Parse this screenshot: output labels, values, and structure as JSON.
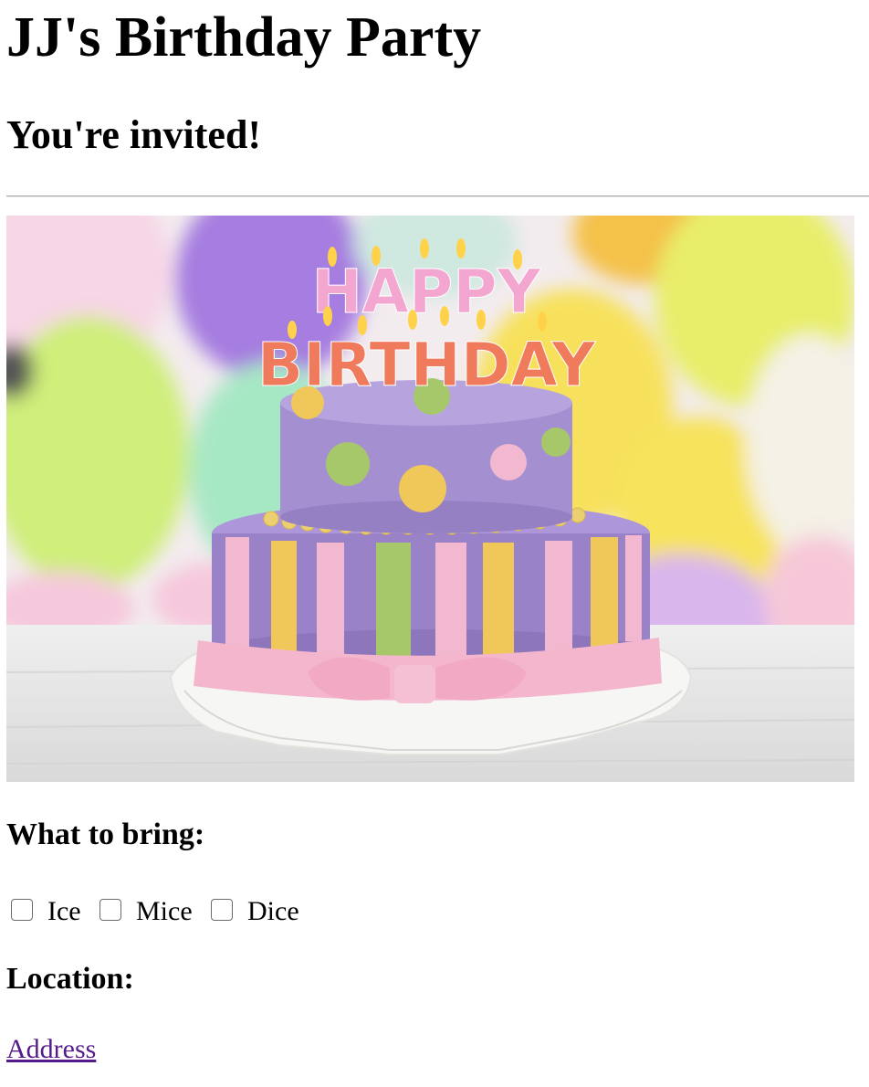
{
  "page": {
    "title": "JJ's Birthday Party",
    "subtitle": "You're invited!"
  },
  "hero": {
    "candles_top": "HAPPY",
    "candles_bottom": "BIRTHDAY"
  },
  "bring": {
    "heading": "What to bring:",
    "options": [
      {
        "label": "Ice",
        "checked": false
      },
      {
        "label": "Mice",
        "checked": false
      },
      {
        "label": "Dice",
        "checked": false
      }
    ]
  },
  "location": {
    "heading": "Location:",
    "link_text": "Address"
  },
  "colors": {
    "link_visited": "#551a8b",
    "cake_purple": "#9a82c8",
    "cake_pink": "#f2b8cf",
    "cake_yellow": "#f0c85a",
    "cake_green": "#a6c86a"
  }
}
